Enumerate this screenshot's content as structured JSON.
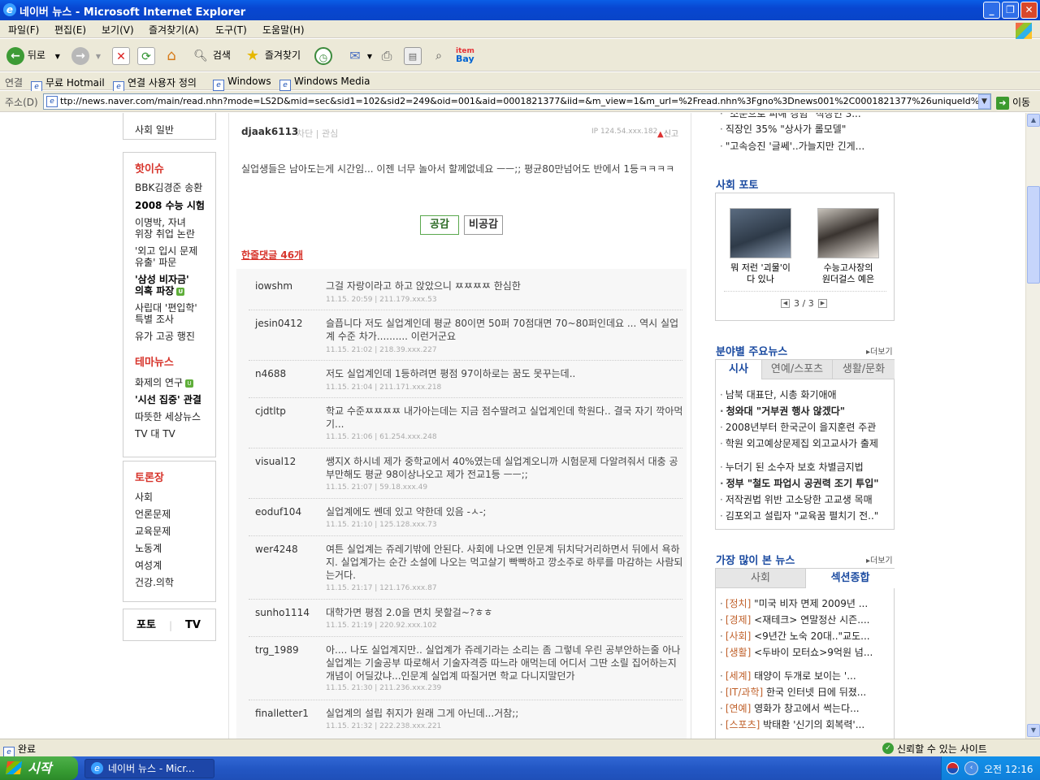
{
  "window": {
    "title": "네이버 뉴스 - Microsoft Internet Explorer"
  },
  "menu": [
    "파일(F)",
    "편집(E)",
    "보기(V)",
    "즐겨찾기(A)",
    "도구(T)",
    "도움말(H)"
  ],
  "toolbar": {
    "back": "뒤로",
    "search": "검색",
    "favorites": "즐겨찾기",
    "ebay_top": "item",
    "ebay_bottom": "Bay"
  },
  "links": {
    "label": "연결",
    "items": [
      "무료 Hotmail",
      "연결 사용자 정의",
      "Windows",
      "Windows Media"
    ]
  },
  "address": {
    "label": "주소(D)",
    "url": "ttp://news.naver.com/main/read.nhn?mode=LS2D&mid=sec&sid1=102&sid2=249&oid=001&aid=0001821377&iid=&m_view=1&m_url=%2Fread.nhn%3Fgno%3Dnews001%2C0001821377%26uniqueId%3D19592",
    "go": "이동"
  },
  "left_nav": {
    "top_item": "사회 일반",
    "hot_issue": {
      "title": "핫이슈",
      "items": [
        "BBK김경준 송환",
        "2008 수능 시험",
        "이명박, 자녀",
        "위장 취업 논란",
        "'외고 입시 문제",
        "유출' 파문",
        "'삼성 비자금'",
        "의혹 파장",
        "사립대 '편입학'",
        "특별 조사",
        "유가 고공 행진"
      ]
    },
    "theme": {
      "title": "테마뉴스",
      "items": [
        "화제의 연구",
        "'시선 집중' 관결",
        "따뜻한 세상뉴스",
        "TV 대 TV"
      ]
    },
    "debate": {
      "title": "토론장",
      "items": [
        "사회",
        "언론문제",
        "교육문제",
        "노동계",
        "여성계",
        "건강.의학"
      ]
    },
    "media": {
      "photo": "포토",
      "tv": "TV"
    }
  },
  "main_comment": {
    "user": "djaak6113",
    "block": "차단",
    "interest": "관심",
    "ip": "IP 124.54.xxx.182",
    "report": "신고",
    "text": "실업생들은 남아도는게 시간임... 이젠 너무 놀아서 할께없네요 ㅡㅡ;; 평균80만넘어도 반에서 1등ㅋㅋㅋㅋ",
    "agree": "공감",
    "disagree": "비공감"
  },
  "comments_header": "한줄댓글 46개",
  "comments": [
    {
      "user": "iowshm",
      "text": "그걸 자랑이라고 하고 앉았으니 ㅉㅉㅉㅉ 한심한",
      "meta": "11.15. 20:59 | 211.179.xxx.53"
    },
    {
      "user": "jesin0412",
      "text": "슬픕니다 저도 실업계인데 평균 80이면 50퍼 70점대면 70~80퍼인데요 ... 역시 실업계 수준 차가.......... 이런거군요",
      "meta": "11.15. 21:02 | 218.39.xxx.227"
    },
    {
      "user": "n4688",
      "text": "저도 실업계인데 1등하려면 평점 97이하로는 꿈도 못꾸는데..",
      "meta": "11.15. 21:04 | 211.171.xxx.218"
    },
    {
      "user": "cjdtltp",
      "text": "학교 수준ㅉㅉㅉㅉ 내가아는데는 지금 점수딸려고 실업계인데 학원다.. 결국 자기 깍아먹기...",
      "meta": "11.15. 21:06 | 61.254.xxx.248"
    },
    {
      "user": "visual12",
      "text": "쌩지X 하시네 제가 중학교에서 40%였는데 실업계오니까 시험문제 다알려줘서 대충 공부만해도 평균 98이상나오고 제가 전교1등 ㅡㅡ;;",
      "meta": "11.15. 21:07 | 59.18.xxx.49"
    },
    {
      "user": "eoduf104",
      "text": "실업계에도 쎈데 있고 약한데 있음 -ㅅ-;",
      "meta": "11.15. 21:10 | 125.128.xxx.73"
    },
    {
      "user": "wer4248",
      "text": "여튼 실업계는 쥬레기밖에 안된다. 사회에 나오면 인문계 뒤치닥거리하면서 뒤에서 욕하지. 실업계가는 순간 소설에 나오는 먹고살기 빡빡하고 깡소주로 하루를 마감하는 사람되는거다.",
      "meta": "11.15. 21:17 | 121.176.xxx.87"
    },
    {
      "user": "sunho1114",
      "text": "대학가면 평점 2.0을 면치 못할걸~?ㅎㅎ",
      "meta": "11.15. 21:19 | 220.92.xxx.102"
    },
    {
      "user": "trg_1989",
      "text": "아.... 나도 실업계지만.. 실업계가 쥬레기라는 소리는 좀 그렇네 우린 공부안하는줄 아나 실업계는 기술공부 따로해서 기술자격증 따느라 애먹는데 어디서 그딴 소릴 집어하는지 개념이 어딜갔냐...인문계 실업계 따질거면 학교 다니지말던가",
      "meta": "11.15. 21:30 | 211.236.xxx.239"
    },
    {
      "user": "finalletter1",
      "text": "실업계의 설립 취지가 원래 그게 아닌데...거참;;",
      "meta": "11.15. 21:32 | 222.238.xxx.221"
    }
  ],
  "right": {
    "top_items": [
      "\"소문으로 피해 경험\" 직장인 3...",
      "직장인 35% \"상사가 롤모델\"",
      "\"고속승진 '글쎄'..가늘지만 긴게..."
    ],
    "photo": {
      "title": "사회 포토",
      "items": [
        {
          "caption_1": "뭐 저런 '괴물'이",
          "caption_2": "다 있나"
        },
        {
          "caption_1": "수능고사장의",
          "caption_2": "원더걸스 예은"
        }
      ],
      "pager": "3 / 3"
    },
    "section_news": {
      "title": "분야별 주요뉴스",
      "more": "더보기",
      "tabs": [
        "시사",
        "연예/스포츠",
        "생활/문화"
      ],
      "group1": [
        "남북 대표단, 시총 화기애애",
        "청와대 \"거부권 행사 않겠다\"",
        "2008년부터 한국군이 을지훈련 주관",
        "학원 외고예상문제집 외고교사가 출제"
      ],
      "group2": [
        "누더기 된 소수자 보호 차별금지법",
        "정부 \"철도 파업시 공권력 조기 투입\"",
        "저작권법 위반 고소당한 고교생 목매",
        "김포외고 설립자 \"교육꿈 펼치기 전..\""
      ]
    },
    "most_viewed": {
      "title": "가장 많이 본 뉴스",
      "more": "더보기",
      "tabs": [
        "사회",
        "섹션종합"
      ],
      "items": [
        {
          "cat": "[정치]",
          "text": "\"미국 비자 면제 2009년 ..."
        },
        {
          "cat": "[경제]",
          "text": "<재테크> 연말정산 시즌...."
        },
        {
          "cat": "[사회]",
          "text": "<9년간 노숙 20대..\"교도..."
        },
        {
          "cat": "[생활]",
          "text": "<두바이 모터쇼>9억원 넘..."
        },
        {
          "cat": "[세계]",
          "text": "태양이 두개로 보이는 '..."
        },
        {
          "cat": "[IT/과학]",
          "text": "한국 인터넷 日에 뒤졌..."
        },
        {
          "cat": "[연예]",
          "text": "영화가 창고에서 썩는다..."
        },
        {
          "cat": "[스포츠]",
          "text": "박태환 '신기의 회복력'..."
        }
      ]
    }
  },
  "statusbar": {
    "status": "완료",
    "zone": "신뢰할 수 있는 사이트"
  },
  "taskbar": {
    "start": "시작",
    "task": "네이버 뉴스 - Micr...",
    "clock": "오전 12:16"
  }
}
